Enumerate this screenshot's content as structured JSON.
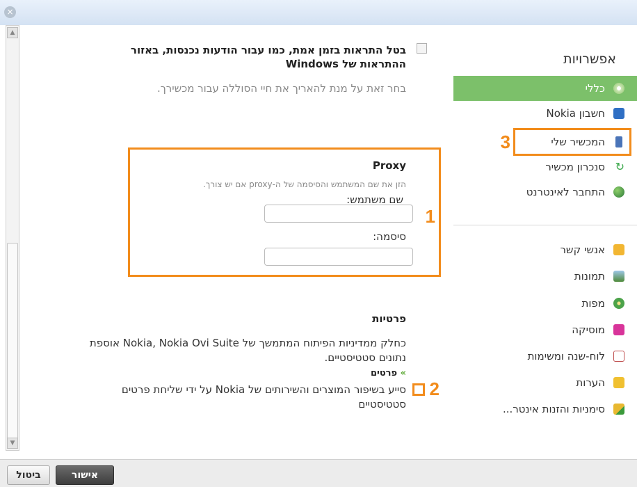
{
  "window": {
    "close_glyph": "×"
  },
  "settings": {
    "notification_checkbox_label": "בטל התראות בזמן אמת, כמו עבור הודעות נכנסות, באזור ההתראות של Windows",
    "notification_hint": "בחר זאת על מנת להאריך את חיי הסוללה עבור מכשירך.",
    "proxy": {
      "title": "Proxy",
      "hint": "הזן את שם המשתמש והסיסמה של ה-proxy אם יש צורך.",
      "username_label": "שם משתמש:",
      "password_label": "סיסמה:",
      "username_value": "",
      "password_value": ""
    },
    "privacy": {
      "title": "פרטיות",
      "text": "כחלק ממדיניות הפיתוח המתמשך של Nokia, Nokia Ovi Suite אוספת נתונים סטטיסטיים.",
      "details_link": "פרטים",
      "details_prefix": "»",
      "stats_checkbox_label": "סייע בשיפור המוצרים והשירותים של Nokia על ידי שליחת פרטים סטטיסטיים"
    }
  },
  "annotations": {
    "n1": "1",
    "n2": "2",
    "n3": "3"
  },
  "sidebar": {
    "title": "אפשרויות",
    "items": [
      {
        "label": "כללי",
        "icon": "gear-icon"
      },
      {
        "label": "חשבון Nokia",
        "icon": "person-icon"
      },
      {
        "label": "המכשיר שלי",
        "icon": "phone-icon"
      },
      {
        "label": "סנכרון מכשיר",
        "icon": "sync-icon"
      },
      {
        "label": "התחבר לאינטרנט",
        "icon": "globe-icon"
      },
      {
        "label": "אנשי קשר",
        "icon": "contacts-icon"
      },
      {
        "label": "תמונות",
        "icon": "photos-icon"
      },
      {
        "label": "מפות",
        "icon": "maps-icon"
      },
      {
        "label": "מוסיקה",
        "icon": "music-icon"
      },
      {
        "label": "לוח-שנה ומשימות",
        "icon": "calendar-icon"
      },
      {
        "label": "הערות",
        "icon": "notes-icon"
      },
      {
        "label": "סימניות והזנות אינטר...",
        "icon": "bookmarks-icon"
      }
    ]
  },
  "footer": {
    "ok_label": "אישור",
    "cancel_label": "ביטול"
  },
  "colors": {
    "accent_orange": "#f28c1c",
    "selected_green": "#7cc06a"
  }
}
